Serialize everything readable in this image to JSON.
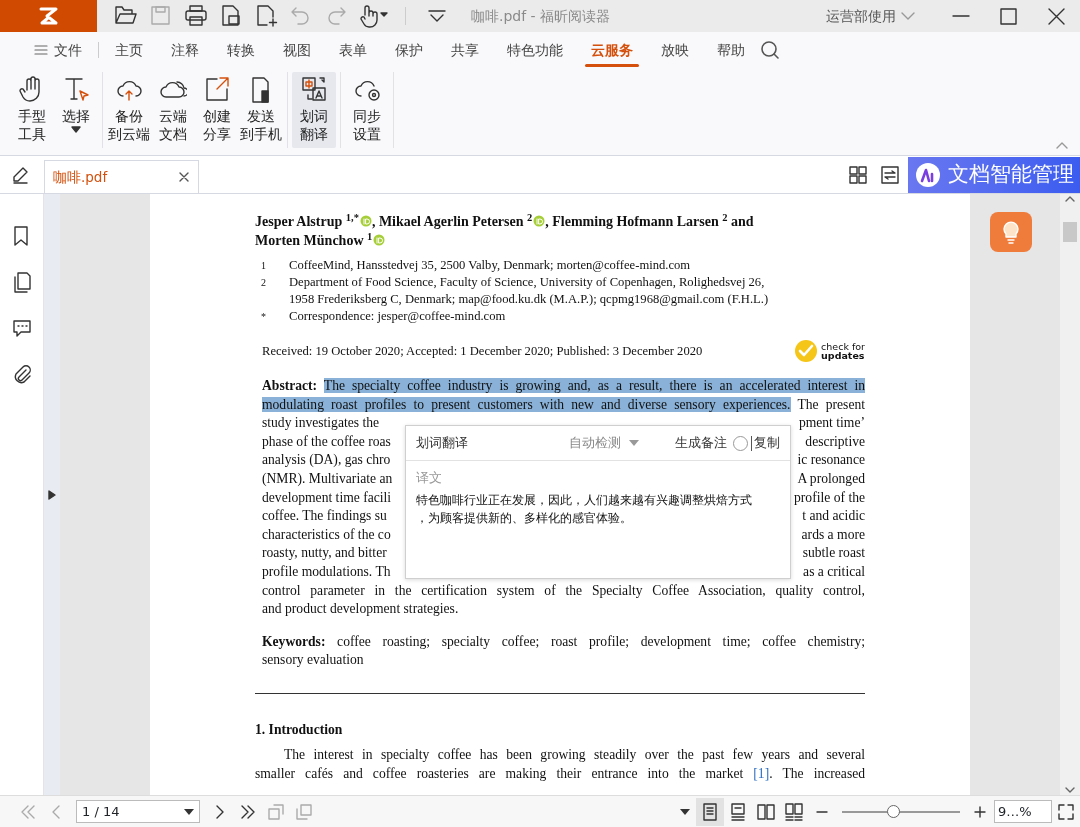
{
  "title_bar": {
    "document_title": "咖啡.pdf - 福昕阅读器",
    "account": "运营部使用"
  },
  "menu_tabs": [
    {
      "label": "文件",
      "selected": false,
      "kind": "file"
    },
    {
      "label": "主页",
      "selected": false
    },
    {
      "label": "注释",
      "selected": false
    },
    {
      "label": "转换",
      "selected": false
    },
    {
      "label": "视图",
      "selected": false
    },
    {
      "label": "表单",
      "selected": false
    },
    {
      "label": "保护",
      "selected": false
    },
    {
      "label": "共享",
      "selected": false
    },
    {
      "label": "特色功能",
      "selected": false
    },
    {
      "label": "云服务",
      "selected": true
    },
    {
      "label": "放映",
      "selected": false
    },
    {
      "label": "帮助",
      "selected": false
    }
  ],
  "ribbon_groups": [
    [
      {
        "lines": [
          "手型",
          "工具"
        ],
        "selected": false
      },
      {
        "lines": [
          "选择"
        ],
        "selected": false,
        "dropdown": true
      }
    ],
    [
      {
        "lines": [
          "备份",
          "到云端"
        ],
        "selected": false
      },
      {
        "lines": [
          "云端",
          "文档"
        ],
        "selected": false
      },
      {
        "lines": [
          "创建",
          "分享"
        ],
        "selected": false
      },
      {
        "lines": [
          "发送",
          "到手机"
        ],
        "selected": false
      }
    ],
    [
      {
        "lines": [
          "划词",
          "翻译"
        ],
        "selected": true
      }
    ],
    [
      {
        "lines": [
          "同步",
          "设置"
        ],
        "selected": false
      }
    ]
  ],
  "doc_tabs": [
    {
      "label": "咖啡.pdf",
      "selected": true
    }
  ],
  "ai_banner": "文档智能管理",
  "paper": {
    "authors": [
      {
        "text": "Jesper Alstrup $^{1,*}$",
        "orcid": true
      },
      {
        "text": ", Mikael Agerlin Petersen $^{2}$",
        "orcid": true
      },
      {
        "text": ", Flemming Hofmann Larsen $^{2}$ and",
        "orcid": false
      },
      {
        "text": "Morten Münchow $^{1}$",
        "orcid": true
      }
    ],
    "affiliations": [
      {
        "mark": "1",
        "lines": [
          "CoffeeMind, Hansstedvej 35, 2500 Valby, Denmark; morten@coffee-mind.com"
        ]
      },
      {
        "mark": "2",
        "lines": [
          "Department of Food Science, Faculty of Science, University of Copenhagen, Rolighedsvej 26,",
          "1958 Frederiksberg C, Denmark; map@food.ku.dk (M.A.P.); qcpmg1968@gmail.com (F.H.L.)"
        ]
      },
      {
        "mark": "*",
        "lines": [
          "Correspondence: jesper@coffee-mind.com"
        ]
      }
    ],
    "dates": "Received: 19 October 2020; Accepted: 1 December 2020; Published: 3 December 2020",
    "check_updates": [
      "check for",
      "updates"
    ],
    "abstract": [
      {
        "kind": "full",
        "segments": [
          {
            "text": "**Abstract:** ",
            "highlighted": false
          },
          {
            "text": "The specialty coffee industry is growing and, as a result, there is an accelerated interest in",
            "highlighted": true
          }
        ]
      },
      {
        "kind": "full",
        "segments": [
          {
            "text": "modulating roast profiles to present customers with new and diverse sensory experiences.",
            "highlighted": true
          },
          {
            "text": " The present",
            "highlighted": false
          }
        ]
      },
      {
        "kind": "split",
        "segments": [
          {
            "text": "study investigates the"
          },
          {
            "text": "pment time’"
          }
        ]
      },
      {
        "kind": "split",
        "segments": [
          {
            "text": "phase of the coffee roas"
          },
          {
            "text": "descriptive"
          }
        ]
      },
      {
        "kind": "split",
        "segments": [
          {
            "text": "analysis (DA), gas chro"
          },
          {
            "text": "ic resonance"
          }
        ]
      },
      {
        "kind": "split",
        "segments": [
          {
            "text": "(NMR). Multivariate an"
          },
          {
            "text": "A prolonged"
          }
        ]
      },
      {
        "kind": "split",
        "segments": [
          {
            "text": "development time facili"
          },
          {
            "text": "profile of the"
          }
        ]
      },
      {
        "kind": "split",
        "segments": [
          {
            "text": "coffee.  The findings su"
          },
          {
            "text": "t and acidic"
          }
        ]
      },
      {
        "kind": "split",
        "segments": [
          {
            "text": "characteristics of the co"
          },
          {
            "text": "ards a more"
          }
        ]
      },
      {
        "kind": "split",
        "segments": [
          {
            "text": "roasty, nutty, and bitter"
          },
          {
            "text": "subtle roast"
          }
        ]
      },
      {
        "kind": "split",
        "segments": [
          {
            "text": "profile modulations. Th"
          },
          {
            "text": "as a critical"
          }
        ]
      },
      {
        "kind": "full",
        "segments": [
          {
            "text": "control parameter in the certification system of the Specialty Coffee Association, quality control,"
          }
        ]
      },
      {
        "kind": "last",
        "segments": [
          {
            "text": "and product development strategies."
          }
        ]
      }
    ],
    "keywords": [
      {
        "kind": "full",
        "segments": [
          {
            "text": "**Keywords:** coffee roasting; specialty coffee; roast profile; development time; coffee chemistry;"
          }
        ]
      },
      {
        "kind": "last",
        "segments": [
          {
            "text": "sensory evaluation"
          }
        ]
      }
    ],
    "section_heading": "1. Introduction",
    "introduction": [
      {
        "kind": "indent",
        "segments": [
          {
            "text": "The interest in specialty coffee has been growing steadily over the past few years and several"
          }
        ]
      },
      {
        "kind": "full",
        "segments": [
          {
            "text": "smaller cafés and coffee roasteries are making their entrance into the market "
          },
          {
            "text": "[1]",
            "kind": "link"
          },
          {
            "text": ".  The increased"
          }
        ]
      }
    ]
  },
  "translation_popup": {
    "title": "划词翻译",
    "language": "自动检测",
    "note_button": "生成备注",
    "copy_button": "复制",
    "result_label": "译文",
    "result_lines": [
      "特色咖啡行业正在发展，因此，人们越来越有兴趣调整烘焙方式",
      "，为顾客提供新的、多样化的感官体验。"
    ]
  },
  "status_bar": {
    "page_field": "1 / 14",
    "zoom": {
      "level": 0.43,
      "value": "9…%"
    }
  }
}
